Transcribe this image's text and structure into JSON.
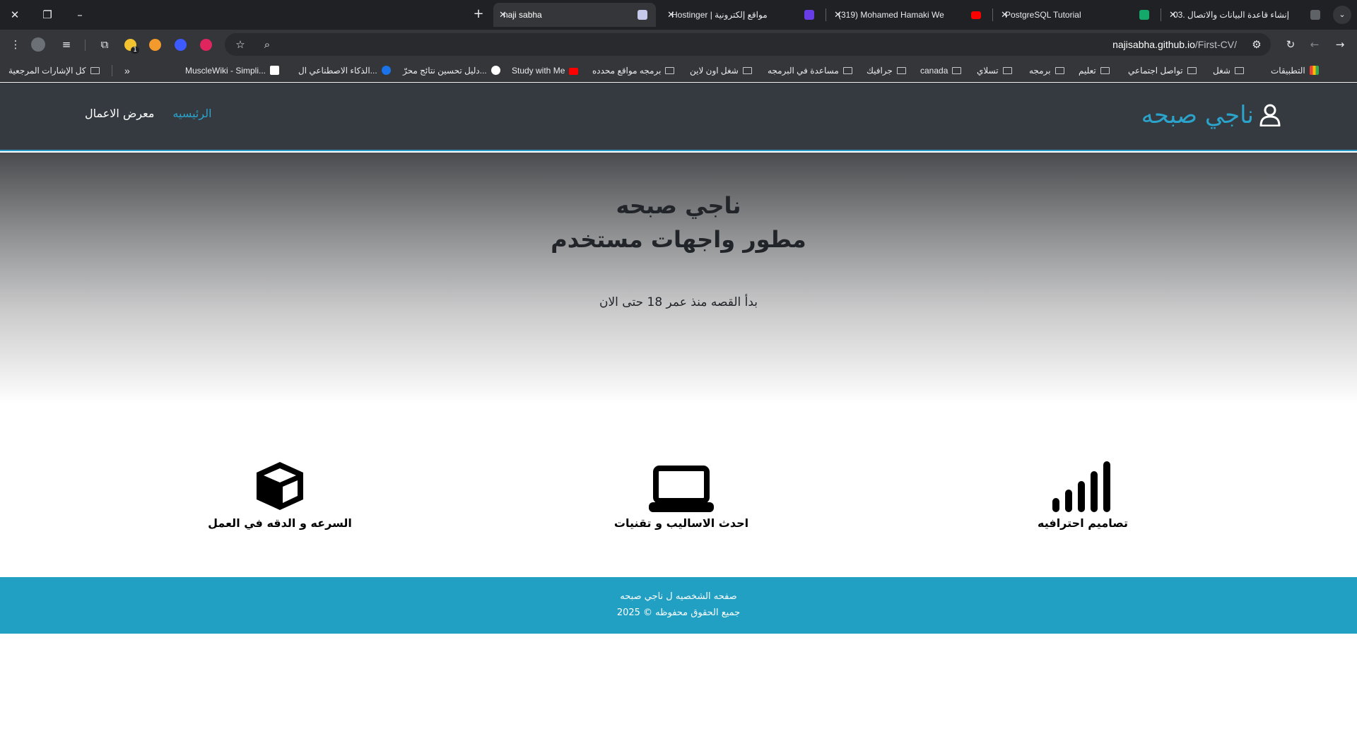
{
  "browser": {
    "tabs": [
      {
        "title": "03. إنشاء قاعدة البيانات والاتصال",
        "active": false
      },
      {
        "title": "PostgreSQL Tutorial",
        "active": false
      },
      {
        "title": "(319) Mohamed Hamaki We",
        "active": false
      },
      {
        "title": "Hostinger | مواقع إلكترونية",
        "active": false
      },
      {
        "title": "naji sabha",
        "active": true
      }
    ],
    "url_domain": "najisabha.github.io",
    "url_path": "/First-CV/",
    "extension_badge": "1",
    "bookmarks": [
      {
        "label": "التطبيقات",
        "kind": "apps"
      },
      {
        "label": "شغل",
        "kind": "folder"
      },
      {
        "label": "تواصل اجتماعي",
        "kind": "folder"
      },
      {
        "label": "تعليم",
        "kind": "folder"
      },
      {
        "label": "برمجه",
        "kind": "folder"
      },
      {
        "label": "تسلاي",
        "kind": "folder"
      },
      {
        "label": "canada",
        "kind": "folder"
      },
      {
        "label": "جرافيك",
        "kind": "folder"
      },
      {
        "label": "مساعدة في البرمجه",
        "kind": "folder"
      },
      {
        "label": "شغل اون لاين",
        "kind": "folder"
      },
      {
        "label": "برمجه مواقع محدده",
        "kind": "folder"
      },
      {
        "label": "Study with Me",
        "kind": "youtube"
      },
      {
        "label": "دليل تحسين نتائج محرّ...",
        "kind": "google"
      },
      {
        "label": "الذكاء الاصطناعي ال...",
        "kind": "c-icon"
      },
      {
        "label": "MuscleWiki - Simpli...",
        "kind": "m-icon"
      }
    ],
    "all_bookmarks": "كل الإشارات المرجعية"
  },
  "site": {
    "brand": "ناجي صبحه",
    "nav": [
      {
        "label": "الرئيسيه",
        "active": true
      },
      {
        "label": "معرض الاعمال",
        "active": false
      }
    ],
    "hero": {
      "name": "ناجي صبحه",
      "role": "مطور واجهات مستخدم",
      "tagline": "بدأ القصه منذ عمر 18 حتى الان"
    },
    "features": [
      {
        "label": "تصاميم احترافيه",
        "icon": "signal-bars-icon"
      },
      {
        "label": "احدث الاساليب و تقنيات",
        "icon": "laptop-icon"
      },
      {
        "label": "السرعه و الدقه في العمل",
        "icon": "box-icon"
      }
    ],
    "footer": {
      "line1": "صفحه الشخصيه ل ناجي صبحه",
      "line2": "جميع الحقوق محفوظه © 2025"
    }
  },
  "colors": {
    "accent": "#2ba3cb",
    "header_bg": "#343a40",
    "footer_bg": "#22a0c4"
  }
}
